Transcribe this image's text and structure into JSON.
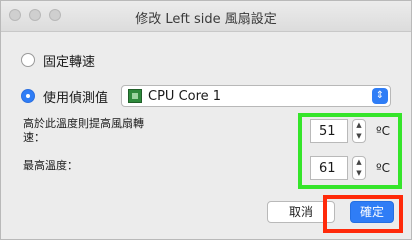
{
  "window": {
    "title": "修改 Left side 風扇設定"
  },
  "options": {
    "fixed_speed_label": "固定轉速",
    "use_sensor_label": "使用偵測值",
    "selected_mode": "use_sensor"
  },
  "sensor_select": {
    "value": "CPU Core 1",
    "icon": "chip-icon"
  },
  "temps": {
    "high_label": "高於此溫度則提高風扇轉速：",
    "high_value": "51",
    "max_label": "最高溫度：",
    "max_value": "61",
    "unit": "ºC"
  },
  "buttons": {
    "cancel": "取消",
    "ok": "確定"
  },
  "highlights": {
    "green": "#35e52a",
    "red": "#ff2a0a"
  }
}
